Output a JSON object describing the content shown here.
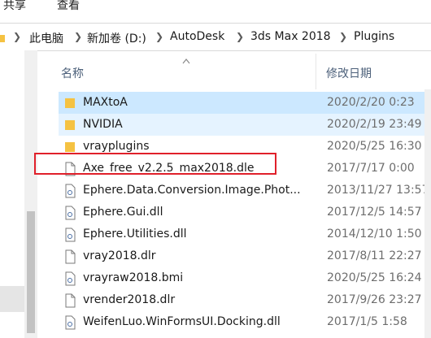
{
  "ribbon": {
    "tabs": [
      "共享",
      "查看"
    ]
  },
  "address": {
    "crumbs": [
      "此电脑",
      "新加卷 (D:)",
      "AutoDesk",
      "3ds Max 2018",
      "Plugins"
    ]
  },
  "columns": {
    "name": "名称",
    "date": "修改日期"
  },
  "rows": [
    {
      "name": "MAXtoA",
      "date": "2020/2/20 0:23",
      "type": "folder",
      "state": "selected"
    },
    {
      "name": "NVIDIA",
      "date": "2020/2/19 23:49",
      "type": "folder",
      "state": "hover"
    },
    {
      "name": "vrayplugins",
      "date": "2020/5/25 16:30",
      "type": "folder",
      "state": "normal"
    },
    {
      "name": "Axe_free_v2.2.5_max2018.dle",
      "date": "2017/7/17 0:00",
      "type": "file",
      "state": "normal"
    },
    {
      "name": "Ephere.Data.Conversion.Image.Phot...",
      "date": "2013/11/27 13:57",
      "type": "dll",
      "state": "normal"
    },
    {
      "name": "Ephere.Gui.dll",
      "date": "2017/12/5 14:57",
      "type": "dll",
      "state": "normal"
    },
    {
      "name": "Ephere.Utilities.dll",
      "date": "2014/12/10 1:50",
      "type": "dll",
      "state": "normal"
    },
    {
      "name": "vray2018.dlr",
      "date": "2017/8/11 22:27",
      "type": "file",
      "state": "normal"
    },
    {
      "name": "vrayraw2018.bmi",
      "date": "2020/5/25 16:24",
      "type": "dll",
      "state": "normal"
    },
    {
      "name": "vrender2018.dlr",
      "date": "2017/9/26 23:27",
      "type": "file",
      "state": "normal"
    },
    {
      "name": "WeifenLuo.WinFormsUI.Docking.dll",
      "date": "2017/1/5 1:58",
      "type": "dll",
      "state": "normal"
    }
  ],
  "colors": {
    "selected": "#cce8ff",
    "hover": "#e5f3ff",
    "annotation": "#e0202a",
    "folder": "#f5c242"
  }
}
